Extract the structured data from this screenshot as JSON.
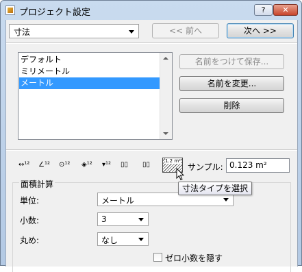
{
  "window": {
    "title": "プロジェクト設定",
    "help_label": "?",
    "close_label": "✕"
  },
  "preset": {
    "selected": "寸法"
  },
  "nav": {
    "prev_label": "<< 前へ",
    "next_label": "次へ >>"
  },
  "presets_list": {
    "items": [
      "デフォルト",
      "ミリメートル",
      "メートル"
    ],
    "selected_index": 2
  },
  "actions": {
    "save_as_label": "名前をつけて保存...",
    "rename_label": "名前を変更...",
    "delete_label": "削除"
  },
  "dimension_types": {
    "items": [
      {
        "icon": "linear-dimension-icon",
        "glyph": "↔¹²"
      },
      {
        "icon": "angle-dimension-icon",
        "glyph": "∠¹²"
      },
      {
        "icon": "radius-dimension-icon",
        "glyph": "⊙¹²"
      },
      {
        "icon": "elevation-dimension-icon",
        "glyph": "◈¹²"
      },
      {
        "icon": "level-dimension-icon",
        "glyph": "▾¹²"
      },
      {
        "icon": "door-window-dimension-icon",
        "glyph": "▯▯"
      },
      {
        "icon": "sill-height-dimension-icon",
        "glyph": "▯▯"
      }
    ],
    "area_glyph": "1.2 m²"
  },
  "sample": {
    "label": "サンプル:",
    "value": "0.123 m²"
  },
  "area_calc": {
    "title": "面積計算",
    "unit_label": "単位:",
    "unit_value": "メートル",
    "decimals_label": "小数:",
    "decimals_value": "3",
    "rounding_label": "丸め:",
    "rounding_value": "なし",
    "hide_zero_decimals_label": "ゼロ小数を隠す",
    "hide_zero_decimals_checked": false
  },
  "tooltip": {
    "text": "寸法タイプを選択"
  },
  "colors": {
    "selection": "#3399ff",
    "titlebar": "#c9dbef"
  }
}
